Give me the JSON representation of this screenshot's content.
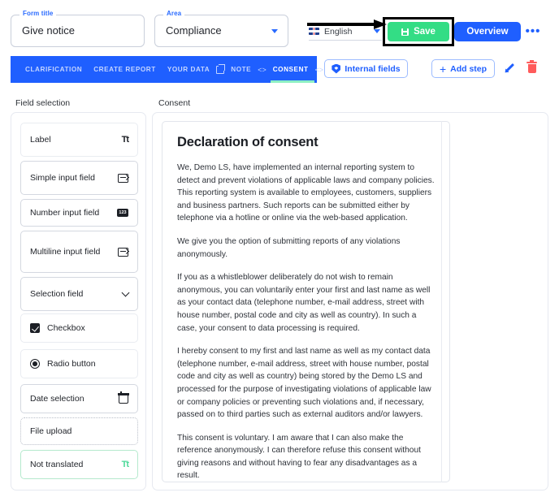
{
  "topbar": {
    "form_title_legend": "Form title",
    "form_title_value": "Give notice",
    "area_legend": "Area",
    "area_value": "Compliance",
    "language_label": "English",
    "save_label": "Save",
    "overview_label": "Overview",
    "more_label": "•••",
    "accent_blue": "#1f5fff",
    "accent_green": "#33dd85"
  },
  "tabs": [
    {
      "label": "CLARIFICATION",
      "active": false
    },
    {
      "label": "CREATE REPORT",
      "active": false
    },
    {
      "label": "YOUR DATA",
      "active": false
    },
    {
      "label": "NOTE",
      "active": false
    },
    {
      "label": "CONSENT",
      "active": true
    }
  ],
  "tab_actions": {
    "internal_fields_label": "Internal fields",
    "add_step_label": "Add step",
    "add_step_plus": "+"
  },
  "labels": {
    "field_selection": "Field selection",
    "consent": "Consent"
  },
  "field_selection": {
    "items": [
      {
        "label": "Label",
        "icon": "text-format-icon",
        "style": "soft"
      },
      {
        "label": "Simple input field",
        "icon": "input-icon",
        "style": "normal"
      },
      {
        "label": "Number input field",
        "icon": "number-icon",
        "style": "normal"
      },
      {
        "label": "Multiline input field",
        "icon": "input-icon",
        "style": "normal"
      },
      {
        "label": "Selection field",
        "icon": "chevron-down-icon",
        "style": "normal"
      },
      {
        "label": "Checkbox",
        "icon": "checkbox-icon",
        "style": "soft"
      },
      {
        "label": "Radio button",
        "icon": "radio-icon",
        "style": "soft"
      },
      {
        "label": "Date selection",
        "icon": "calendar-icon",
        "style": "normal"
      },
      {
        "label": "File upload",
        "icon": "none",
        "style": "dotted"
      },
      {
        "label": "Not translated",
        "icon": "text-format-icon-green",
        "style": "green"
      }
    ],
    "number_icon_text": "123"
  },
  "consent_block": {
    "heading": "Declaration of consent",
    "paragraphs": [
      "We, Demo LS, have implemented an internal reporting system to detect and prevent violations of applicable laws and company policies. This reporting system is available to employees, customers, suppliers and business partners. Such reports can be submitted either by telephone via a hotline or online via the web-based application.",
      "We give you the option of submitting reports of any violations anonymously.",
      "If you as a whistleblower deliberately do not wish to remain anonymous, you can voluntarily enter your first and last name as well as your contact data (telephone number, e-mail address, street with house number, postal code and city as well as country). In such a case, your consent to data processing is required.",
      "I hereby consent to my first and last name as well as my contact data (telephone number, e-mail address, street with house number, postal code and city as well as country) being stored by the Demo LS and processed for the purpose of investigating violations of applicable law or company policies or preventing such violations and, if necessary, passed on to third parties such as external auditors and/or lawyers.",
      "This consent is voluntary. I am aware that I can also make the reference anonymously. I can therefore refuse this consent without giving reasons and without having to fear any disadvantages as a result."
    ],
    "inline_tt_icon": "Tt"
  }
}
